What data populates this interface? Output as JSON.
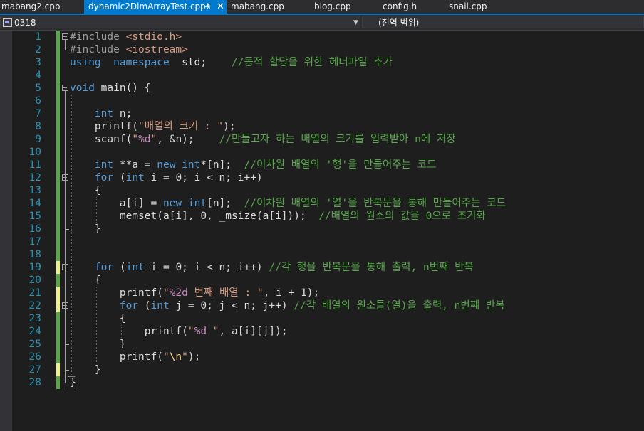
{
  "tabs": [
    {
      "label": "mabang2.cpp",
      "active": false
    },
    {
      "label": "dynamic2DimArrayTest.cpp*",
      "active": true
    },
    {
      "label": "mabang.cpp",
      "active": false
    },
    {
      "label": "blog.cpp",
      "active": false
    },
    {
      "label": "config.h",
      "active": false
    },
    {
      "label": "snail.cpp",
      "active": false
    }
  ],
  "tab_icons": {
    "pin": "⇥",
    "close": "✕"
  },
  "navbar": {
    "project_combo": "0318",
    "scope_combo": "(전역 범위)"
  },
  "colors": {
    "accent": "#007acc",
    "background": "#1e1e1e",
    "keyword": "#569cd6",
    "string": "#d69d85",
    "comment": "#57a64a",
    "line_number": "#2b91af",
    "saved_change": "#57a64a",
    "unsaved_change": "#efef91"
  },
  "editor": {
    "lines": [
      {
        "n": "1",
        "change": "saved",
        "fold": "open",
        "tokens": [
          [
            "pp",
            "#include "
          ],
          [
            "inc",
            "<stdio.h>"
          ]
        ]
      },
      {
        "n": "2",
        "change": "saved",
        "fold": "",
        "tokens": [
          [
            "pp",
            "#include "
          ],
          [
            "inc",
            "<iostream>"
          ]
        ]
      },
      {
        "n": "3",
        "change": "saved",
        "fold": "",
        "tokens": [
          [
            "kw",
            "using"
          ],
          [
            "",
            "  "
          ],
          [
            "kw",
            "namespace"
          ],
          [
            "",
            "  std;    "
          ],
          [
            "cmt",
            "//동적 할당을 위한 헤더파일 추가"
          ]
        ]
      },
      {
        "n": "4",
        "change": "saved",
        "fold": "",
        "tokens": []
      },
      {
        "n": "5",
        "change": "saved",
        "fold": "open",
        "tokens": [
          [
            "kw",
            "void"
          ],
          [
            "",
            " main() {"
          ]
        ]
      },
      {
        "n": "6",
        "change": "saved",
        "fold": "",
        "tokens": []
      },
      {
        "n": "7",
        "change": "saved",
        "fold": "",
        "tokens": [
          [
            "",
            "    "
          ],
          [
            "kw",
            "int"
          ],
          [
            "",
            " n;"
          ]
        ]
      },
      {
        "n": "8",
        "change": "saved",
        "fold": "",
        "tokens": [
          [
            "",
            "    printf("
          ],
          [
            "str",
            "\"배열의 크기 : \""
          ],
          [
            "",
            ");"
          ]
        ]
      },
      {
        "n": "9",
        "change": "saved",
        "fold": "",
        "tokens": [
          [
            "",
            "    scanf("
          ],
          [
            "str",
            "\""
          ],
          [
            "fmt",
            "%d"
          ],
          [
            "str",
            "\""
          ],
          [
            "",
            ", &n);    "
          ],
          [
            "cmt",
            "//만들고자 하는 배열의 크기를 입력받아 n에 저장"
          ]
        ]
      },
      {
        "n": "10",
        "change": "saved",
        "fold": "",
        "tokens": []
      },
      {
        "n": "11",
        "change": "saved",
        "fold": "",
        "tokens": [
          [
            "",
            "    "
          ],
          [
            "kw",
            "int"
          ],
          [
            "",
            " **a = "
          ],
          [
            "kw",
            "new"
          ],
          [
            "",
            " "
          ],
          [
            "kw",
            "int"
          ],
          [
            "",
            "*[n];  "
          ],
          [
            "cmt",
            "//이차원 배열의 '행'을 만들어주는 코드"
          ]
        ]
      },
      {
        "n": "12",
        "change": "saved",
        "fold": "open",
        "tokens": [
          [
            "",
            "    "
          ],
          [
            "kw",
            "for"
          ],
          [
            "",
            " ("
          ],
          [
            "kw",
            "int"
          ],
          [
            "",
            " i = 0; i < n; i++)"
          ]
        ]
      },
      {
        "n": "13",
        "change": "saved",
        "fold": "",
        "tokens": [
          [
            "",
            "    {"
          ]
        ]
      },
      {
        "n": "14",
        "change": "saved",
        "fold": "",
        "tokens": [
          [
            "",
            "        a[i] = "
          ],
          [
            "kw",
            "new"
          ],
          [
            "",
            " "
          ],
          [
            "kw",
            "int"
          ],
          [
            "",
            "[n];  "
          ],
          [
            "cmt",
            "//이차원 배열의 '열'을 반복문을 통해 만들어주는 코드"
          ]
        ]
      },
      {
        "n": "15",
        "change": "saved",
        "fold": "",
        "tokens": [
          [
            "",
            "        memset(a[i], 0, _msize(a[i]));  "
          ],
          [
            "cmt",
            "//배열의 원소의 값을 0으로 초기화"
          ]
        ]
      },
      {
        "n": "16",
        "change": "saved",
        "fold": "",
        "tokens": [
          [
            "",
            "    }"
          ]
        ]
      },
      {
        "n": "17",
        "change": "saved",
        "fold": "",
        "tokens": []
      },
      {
        "n": "18",
        "change": "saved",
        "fold": "",
        "tokens": []
      },
      {
        "n": "19",
        "change": "unsaved",
        "fold": "open",
        "tokens": [
          [
            "",
            "    "
          ],
          [
            "kw",
            "for"
          ],
          [
            "",
            " ("
          ],
          [
            "kw",
            "int"
          ],
          [
            "",
            " i = 0; i < n; i++) "
          ],
          [
            "cmt",
            "//각 행을 반복문을 통해 출력, n번째 반복"
          ]
        ]
      },
      {
        "n": "20",
        "change": "saved",
        "fold": "",
        "tokens": [
          [
            "",
            "    {"
          ]
        ]
      },
      {
        "n": "21",
        "change": "unsaved",
        "fold": "",
        "tokens": [
          [
            "",
            "        printf("
          ],
          [
            "str",
            "\""
          ],
          [
            "fmt",
            "%2d"
          ],
          [
            "str",
            " 번째 배열 : \""
          ],
          [
            "",
            ", i + 1);"
          ]
        ]
      },
      {
        "n": "22",
        "change": "unsaved",
        "fold": "open",
        "tokens": [
          [
            "",
            "        "
          ],
          [
            "kw",
            "for"
          ],
          [
            "",
            " ("
          ],
          [
            "kw",
            "int"
          ],
          [
            "",
            " j = 0; j < n; j++) "
          ],
          [
            "cmt",
            "//각 배열의 원소들(열)을 출력, n번째 반복"
          ]
        ]
      },
      {
        "n": "23",
        "change": "saved",
        "fold": "",
        "tokens": [
          [
            "",
            "        {"
          ]
        ]
      },
      {
        "n": "24",
        "change": "saved",
        "fold": "",
        "tokens": [
          [
            "",
            "            printf("
          ],
          [
            "str",
            "\""
          ],
          [
            "fmt",
            "%d"
          ],
          [
            "str",
            " \""
          ],
          [
            "",
            ", a[i][j]);"
          ]
        ]
      },
      {
        "n": "25",
        "change": "saved",
        "fold": "",
        "tokens": [
          [
            "",
            "        }"
          ]
        ]
      },
      {
        "n": "26",
        "change": "saved",
        "fold": "",
        "tokens": [
          [
            "",
            "        printf("
          ],
          [
            "str",
            "\""
          ],
          [
            "esc",
            "\\n"
          ],
          [
            "str",
            "\""
          ],
          [
            "",
            ");"
          ]
        ]
      },
      {
        "n": "27",
        "change": "unsaved",
        "fold": "",
        "tokens": [
          [
            "",
            "    }"
          ]
        ]
      },
      {
        "n": "28",
        "change": "saved",
        "fold": "",
        "tokens": [
          [
            "",
            "}"
          ]
        ]
      }
    ]
  }
}
